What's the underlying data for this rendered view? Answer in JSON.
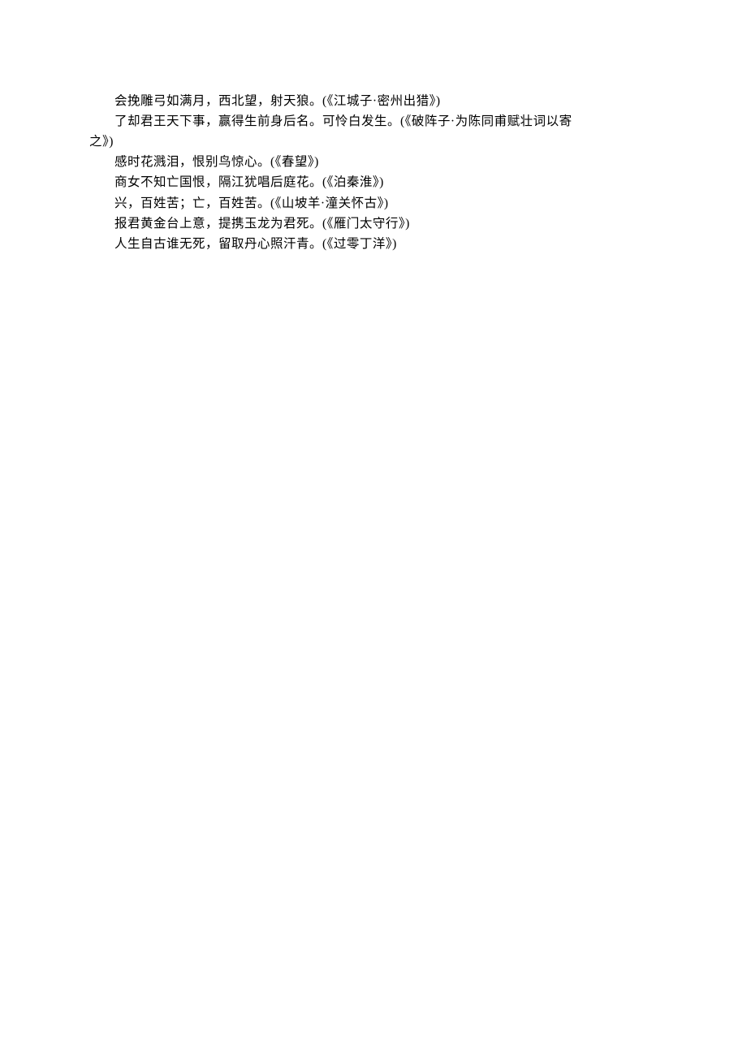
{
  "document": {
    "lines": [
      "会挽雕弓如满月，西北望，射天狼。(《江城子·密州出猎》)",
      "了却君王天下事，赢得生前身后名。可怜白发生。(《破阵子·为陈同甫赋壮词以寄之》)",
      "感时花溅泪，恨别鸟惊心。(《春望》)",
      "商女不知亡国恨，隔江犹唱后庭花。(《泊秦淮》)",
      "兴，百姓苦；亡，百姓苦。(《山坡羊·潼关怀古》)",
      "报君黄金台上意，提携玉龙为君死。(《雁门太守行》)",
      "人生自古谁无死，留取丹心照汗青。(《过零丁洋》)"
    ],
    "line1": "会挽雕弓如满月，西北望，射天狼。(《江城子·密州出猎》)",
    "line2a": "了却君王天下事，赢得生前身后名。可怜白发生。(《破阵子·为陈同甫赋壮词以寄",
    "line2b": "之》)",
    "line3": "感时花溅泪，恨别鸟惊心。(《春望》)",
    "line4": "商女不知亡国恨，隔江犹唱后庭花。(《泊秦淮》)",
    "line5": "兴，百姓苦；亡，百姓苦。(《山坡羊·潼关怀古》)",
    "line6": "报君黄金台上意，提携玉龙为君死。(《雁门太守行》)",
    "line7": "人生自古谁无死，留取丹心照汗青。(《过零丁洋》)"
  }
}
